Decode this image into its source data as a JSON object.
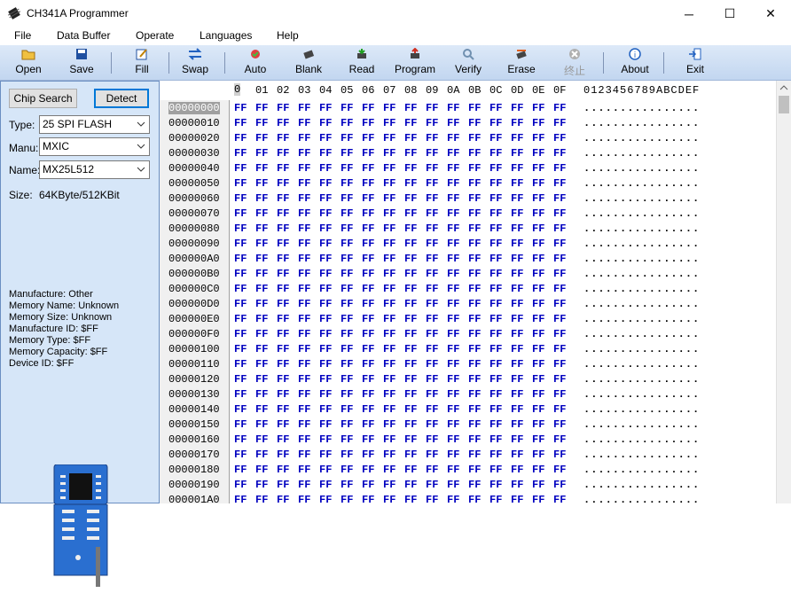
{
  "window": {
    "title": "CH341A Programmer",
    "minimize": "─",
    "maximize": "☐",
    "close": "✕"
  },
  "menu": [
    "File",
    "Data Buffer",
    "Operate",
    "Languages",
    "Help"
  ],
  "toolbar": {
    "open": "Open",
    "save": "Save",
    "fill": "Fill",
    "swap": "Swap",
    "auto": "Auto",
    "blank": "Blank",
    "read": "Read",
    "program": "Program",
    "verify": "Verify",
    "erase": "Erase",
    "stop": "终止",
    "about": "About",
    "exit": "Exit"
  },
  "left": {
    "chip_search": "Chip Search",
    "detect": "Detect",
    "type_label": "Type:",
    "type_value": "25 SPI FLASH",
    "manu_label": "Manu:",
    "manu_value": "MXIC",
    "name_label": "Name:",
    "name_value": "MX25L512",
    "size_label": "Size:",
    "size_value": "64KByte/512KBit",
    "info": [
      "Manufacture: Other",
      "Memory Name: Unknown",
      "Memory Size: Unknown",
      "Manufacture ID: $FF",
      "Memory Type: $FF",
      "Memory Capacity: $FF",
      "Device ID: $FF"
    ]
  },
  "hex": {
    "columns": [
      "0",
      "01",
      "02",
      "03",
      "04",
      "05",
      "06",
      "07",
      "08",
      "09",
      "0A",
      "0B",
      "0C",
      "0D",
      "0E",
      "0F"
    ],
    "ascii_header": "0123456789ABCDEF",
    "cursor_char": "0",
    "byte_value": "FF",
    "ascii_row": "................",
    "rows": [
      "00000000",
      "00000010",
      "00000020",
      "00000030",
      "00000040",
      "00000050",
      "00000060",
      "00000070",
      "00000080",
      "00000090",
      "000000A0",
      "000000B0",
      "000000C0",
      "000000D0",
      "000000E0",
      "000000F0",
      "00000100",
      "00000110",
      "00000120",
      "00000130",
      "00000140",
      "00000150",
      "00000160",
      "00000170",
      "00000180",
      "00000190",
      "000001A0"
    ]
  }
}
